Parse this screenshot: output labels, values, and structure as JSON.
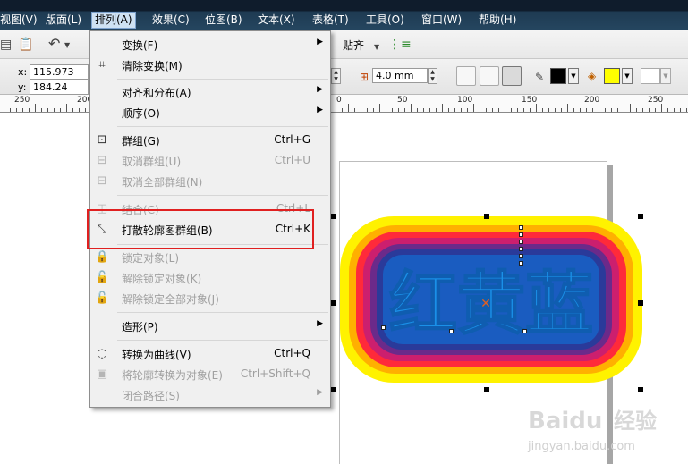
{
  "menubar": {
    "items": [
      {
        "label": "视图(V)"
      },
      {
        "label": "版面(L)"
      },
      {
        "label": "排列(A)",
        "active": true
      },
      {
        "label": "效果(C)"
      },
      {
        "label": "位图(B)"
      },
      {
        "label": "文本(X)"
      },
      {
        "label": "表格(T)"
      },
      {
        "label": "工具(O)"
      },
      {
        "label": "窗口(W)"
      },
      {
        "label": "帮助(H)"
      }
    ]
  },
  "toolbar": {
    "snap_label": "贴齐"
  },
  "properties": {
    "x_label": "x:",
    "x_value": "115.973 mm",
    "y_label": "y:",
    "y_value": "184.24 mm",
    "outline_width": "4.0 mm",
    "fill_color": "#ffff00",
    "outline_color": "#000000"
  },
  "ruler": {
    "labels": [
      "250",
      "200",
      "0",
      "50",
      "100",
      "150",
      "200",
      "250"
    ]
  },
  "menu": {
    "items": [
      {
        "label": "变换(F)",
        "submenu": true,
        "icon": "none"
      },
      {
        "label": "清除变换(M)",
        "icon": "clear-transform-icon"
      },
      {
        "label": "对齐和分布(A)",
        "submenu": true
      },
      {
        "label": "顺序(O)",
        "submenu": true
      },
      {
        "label": "群组(G)",
        "shortcut": "Ctrl+G",
        "icon": "group-icon"
      },
      {
        "label": "取消群组(U)",
        "shortcut": "Ctrl+U",
        "disabled": true,
        "icon": "ungroup-icon"
      },
      {
        "label": "取消全部群组(N)",
        "disabled": true,
        "icon": "ungroup-all-icon"
      },
      {
        "label": "结合(C)",
        "shortcut": "Ctrl+L",
        "disabled": true,
        "icon": "combine-icon"
      },
      {
        "label": "打散轮廓图群组(B)",
        "shortcut": "Ctrl+K",
        "icon": "break-apart-icon"
      },
      {
        "label": "锁定对象(L)",
        "disabled": true,
        "icon": "lock-icon"
      },
      {
        "label": "解除锁定对象(K)",
        "disabled": true,
        "icon": "unlock-icon"
      },
      {
        "label": "解除锁定全部对象(J)",
        "disabled": true,
        "icon": "unlock-all-icon"
      },
      {
        "label": "造形(P)",
        "submenu": true
      },
      {
        "label": "转换为曲线(V)",
        "shortcut": "Ctrl+Q",
        "icon": "convert-curve-icon"
      },
      {
        "label": "将轮廓转换为对象(E)",
        "shortcut": "Ctrl+Shift+Q",
        "disabled": true,
        "icon": "outline-object-icon"
      },
      {
        "label": "闭合路径(S)",
        "submenu": true,
        "disabled": true
      }
    ]
  },
  "artwork": {
    "text": "红黄蓝",
    "colors": {
      "outer": "#fff200",
      "orange": "#ff9a00",
      "red": "#ff2a3a",
      "magenta": "#cc1f6e",
      "purple": "#6b2a8a",
      "navy": "#2a3a9a",
      "blue": "#1a78d8",
      "text_blue": "#1a90e8"
    }
  },
  "watermark": {
    "brand": "Baidu",
    "cn": "经验",
    "url": "jingyan.baidu.com"
  }
}
